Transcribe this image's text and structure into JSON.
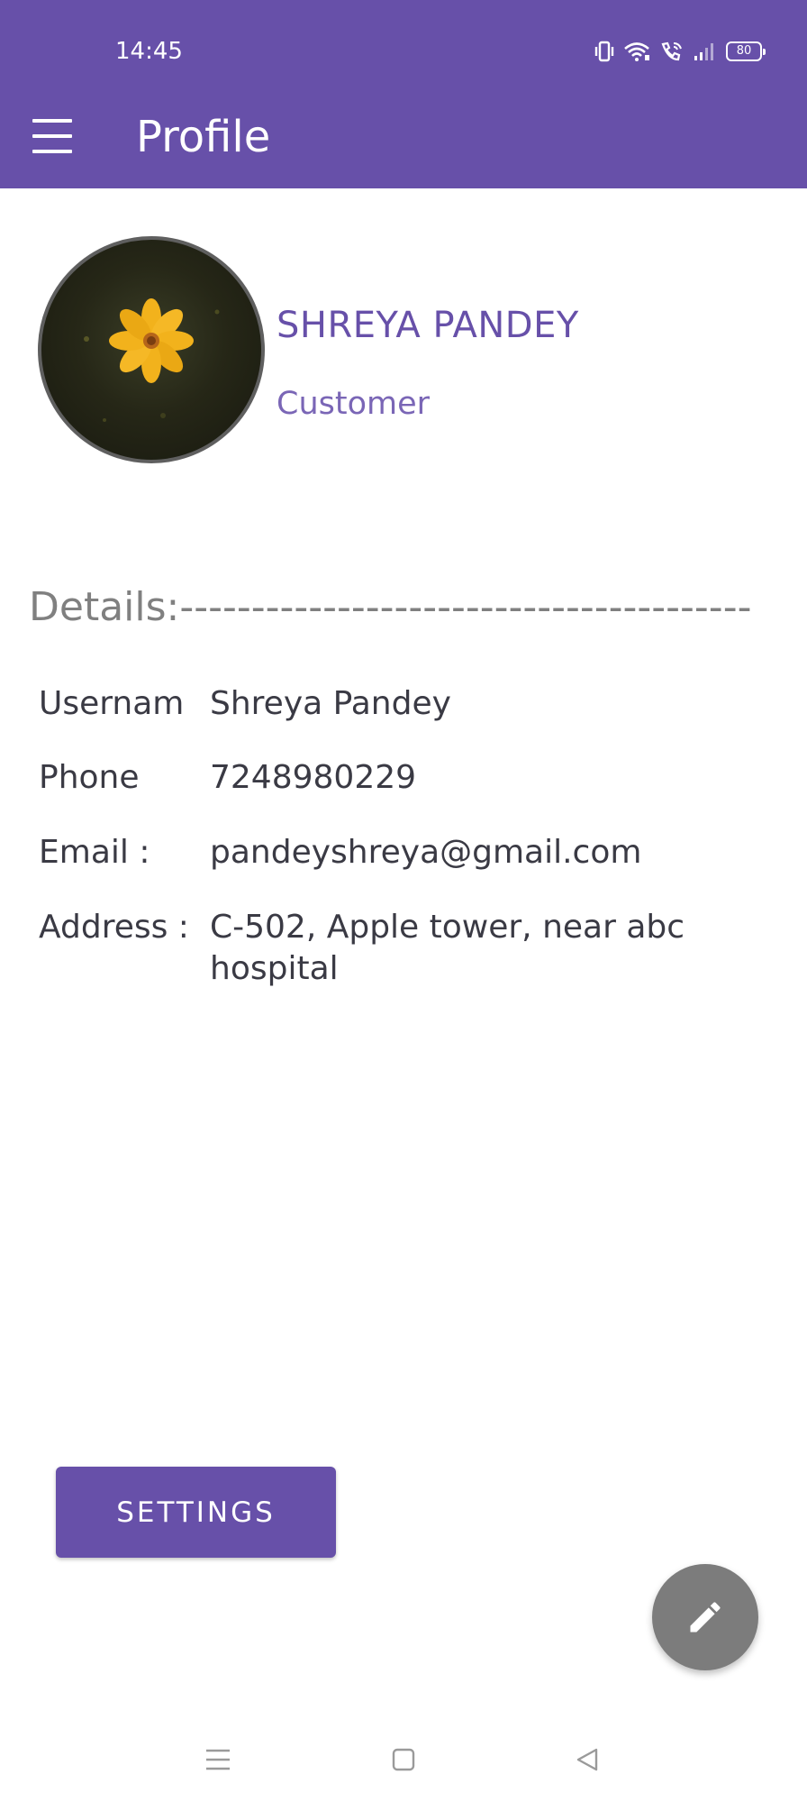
{
  "status_bar": {
    "time": "14:45",
    "battery": "80",
    "icons": [
      "vibrate-icon",
      "wifi-icon",
      "wifi-calling-icon",
      "signal-icon",
      "battery-icon"
    ]
  },
  "app_bar": {
    "title": "Profile",
    "menu_icon": "hamburger-menu-icon"
  },
  "profile": {
    "name": "SHREYA PANDEY",
    "role": "Customer",
    "avatar": "yellow-flower-photo"
  },
  "details": {
    "heading": "Details:----------------------------------------",
    "rows": [
      {
        "label": "Usernam",
        "value": "Shreya Pandey"
      },
      {
        "label": "Phone",
        "value": "7248980229"
      },
      {
        "label": "Email :",
        "value": "pandeyshreya@gmail.com"
      },
      {
        "label": "Address :",
        "value": "C-502, Apple tower, near abc hospital"
      }
    ]
  },
  "actions": {
    "settings_label": "SETTINGS",
    "edit_icon": "pencil-icon"
  },
  "nav_bar": {
    "icons": [
      "recents-icon",
      "home-icon",
      "back-icon"
    ]
  },
  "colors": {
    "primary": "#6750a9",
    "fab": "#7c7c7c",
    "heading_gray": "#808080",
    "text_dark": "#3a3a44"
  }
}
